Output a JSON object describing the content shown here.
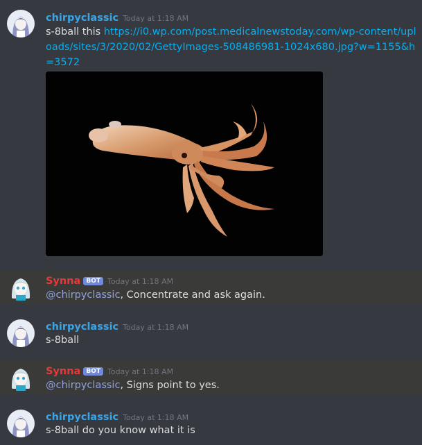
{
  "messages": [
    {
      "author": "chirpyclassic",
      "timestamp": "Today at 1:18 AM",
      "text_prefix": "s-8ball this ",
      "link": "https://i0.wp.com/post.medicalnewstoday.com/wp-content/uploads/sites/3/2020/02/GettyImages-508486981-1024x680.jpg?w=1155&h=3572",
      "attachment": "squid-image"
    },
    {
      "author": "Synna",
      "bot_badge": "BOT",
      "timestamp": "Today at 1:18 AM",
      "mention": "@chirpyclassic",
      "text": ", Concentrate and ask again."
    },
    {
      "author": "chirpyclassic",
      "timestamp": "Today at 1:18 AM",
      "text": "s-8ball"
    },
    {
      "author": "Synna",
      "bot_badge": "BOT",
      "timestamp": "Today at 1:18 AM",
      "mention": "@chirpyclassic",
      "text": ", Signs point to yes."
    },
    {
      "author": "chirpyclassic",
      "timestamp": "Today at 1:18 AM",
      "text": "s-8ball do you know what it is"
    }
  ],
  "colors": {
    "background": "#36393f",
    "bot_message_highlight": "#3a3a38",
    "user_name": "#3aa5e6",
    "bot_name": "#e63a3a",
    "link": "#00b0f4",
    "mention": "#8ea1e1"
  }
}
